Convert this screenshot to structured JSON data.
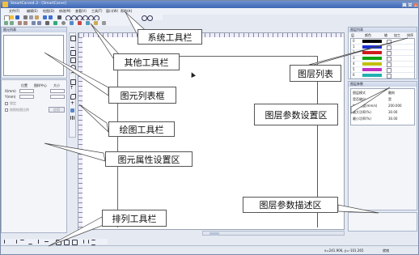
{
  "title": "SmartCarve4.3 - [SmartCarve]",
  "menu": [
    "文件(F)",
    "编辑(E)",
    "绘图(D)",
    "修改(M)",
    "查看(V)",
    "工具(T)",
    "窗口(W)",
    "帮助(H)"
  ],
  "left_panel": {
    "list_title": "图元列表",
    "props": {
      "headers": [
        "位置",
        "图样中心",
        "大小"
      ],
      "rows": [
        "X(mm)",
        "Y(mm)"
      ],
      "check1": "锁定",
      "check2": "按照绘图比例",
      "apply": "应用"
    }
  },
  "layer_list": {
    "title": "图层列表",
    "headers": [
      "层",
      "颜色",
      "输",
      "加工",
      "排序"
    ],
    "rows": [
      {
        "num": "0",
        "color": "#000000"
      },
      {
        "num": "1",
        "color": "#1a2fd0"
      },
      {
        "num": "2",
        "color": "#d01a1a"
      },
      {
        "num": "3",
        "color": "#10a010"
      },
      {
        "num": "4",
        "color": "#c0c000"
      },
      {
        "num": "5",
        "color": "#c030c0"
      },
      {
        "num": "6",
        "color": "#20b0b0"
      }
    ]
  },
  "layer_params": {
    "title": "图层参数",
    "rows": [
      {
        "label": "图层模式",
        "value": "雕刻"
      },
      {
        "label": "是否输出",
        "value": "是"
      },
      {
        "label": "加工速度(mm/s)",
        "value": "200.000"
      },
      {
        "label": "最大功率(%)",
        "value": "30.00"
      },
      {
        "label": "最小功率(%)",
        "value": "30.00"
      }
    ]
  },
  "status": {
    "coords": "x=241.906, y=-101.265",
    "mode": "就绪"
  },
  "callouts": {
    "system_toolbar": "系统工具栏",
    "other_toolbar": "其他工具栏",
    "element_list": "图元列表框",
    "layer_list": "图层列表",
    "layer_params": "图层参数设置区",
    "draw_toolbar": "绘图工具栏",
    "element_props": "图元属性设置区",
    "layer_desc": "图层参数描述区",
    "arrange_toolbar": "排列工具栏"
  },
  "colors": {
    "title_bar": "#3c66b4",
    "panel": "#f3f5f9",
    "canvas": "#ffffff"
  }
}
